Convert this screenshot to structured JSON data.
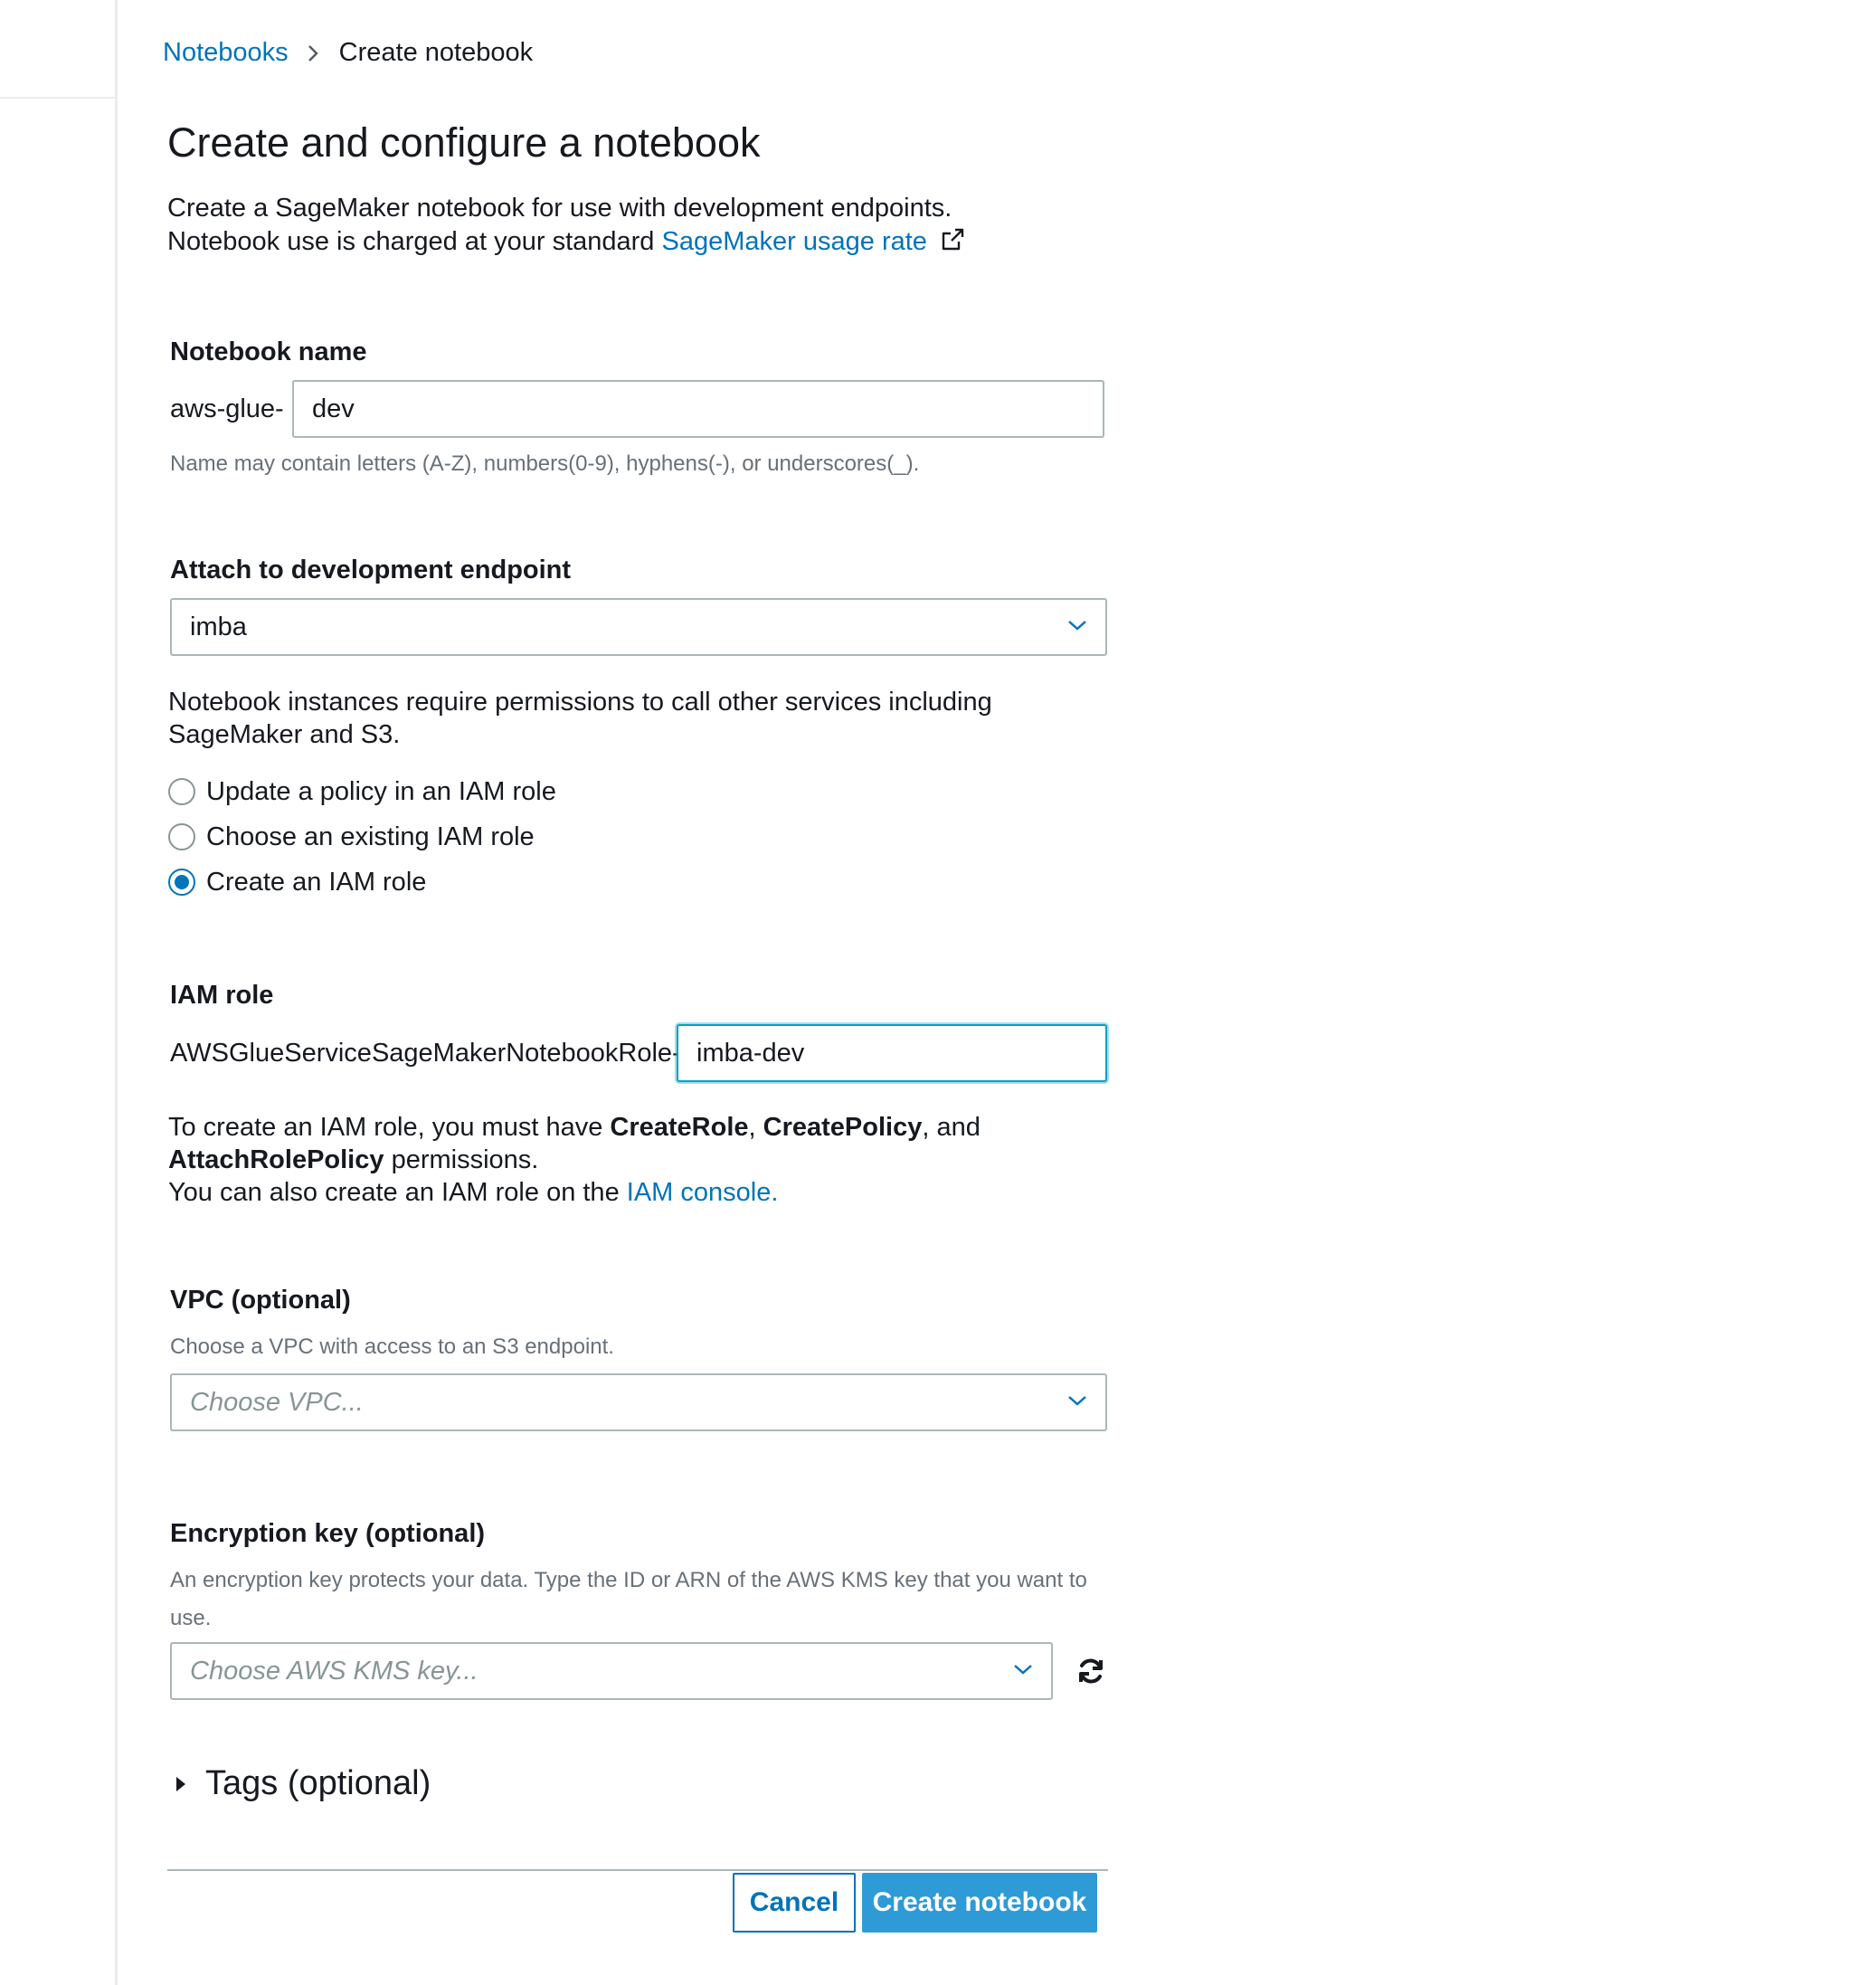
{
  "breadcrumb": {
    "parent_label": "Notebooks",
    "current_label": "Create notebook"
  },
  "page": {
    "title": "Create and configure a notebook",
    "intro_line1": "Create a SageMaker notebook for use with development endpoints.",
    "intro_line2_prefix": "Notebook use is charged at your standard",
    "intro_link": "SageMaker usage rate"
  },
  "notebook_name": {
    "label": "Notebook name",
    "prefix": "aws-glue-",
    "value": "dev",
    "hint": "Name may contain letters (A-Z), numbers(0-9), hyphens(-), or underscores(_)."
  },
  "endpoint": {
    "label": "Attach to development endpoint",
    "selected": "imba",
    "permissions_note": "Notebook instances require permissions to call other services including SageMaker and S3.",
    "role_options": [
      {
        "label": "Update a policy in an IAM role",
        "checked": false
      },
      {
        "label": "Choose an existing IAM role",
        "checked": false
      },
      {
        "label": "Create an IAM role",
        "checked": true
      }
    ]
  },
  "iam_role": {
    "label": "IAM role",
    "prefix": "AWSGlueServiceSageMakerNotebookRole-",
    "value": "imba-dev",
    "note_part1": "To create an IAM role, you must have",
    "perm1": "CreateRole",
    "sep1": ",",
    "perm2": "CreatePolicy",
    "sep2": ", and",
    "perm3": "AttachRolePolicy",
    "note_part2": "permissions.",
    "console_prefix": "You can also create an IAM role on the",
    "console_link": "IAM console."
  },
  "vpc": {
    "label": "VPC (optional)",
    "hint": "Choose a VPC with access to an S3 endpoint.",
    "placeholder": "Choose VPC..."
  },
  "encryption": {
    "label": "Encryption key (optional)",
    "hint": "An encryption key protects your data. Type the ID or ARN of the AWS KMS key that you want to use.",
    "placeholder": "Choose AWS KMS key..."
  },
  "tags": {
    "label": "Tags (optional)"
  },
  "actions": {
    "cancel_label": "Cancel",
    "create_label": "Create notebook"
  },
  "colors": {
    "link": "#0073bb",
    "primary_button": "#2e9bd6",
    "focus_border": "#00a1c9",
    "border": "#aab7b8"
  }
}
